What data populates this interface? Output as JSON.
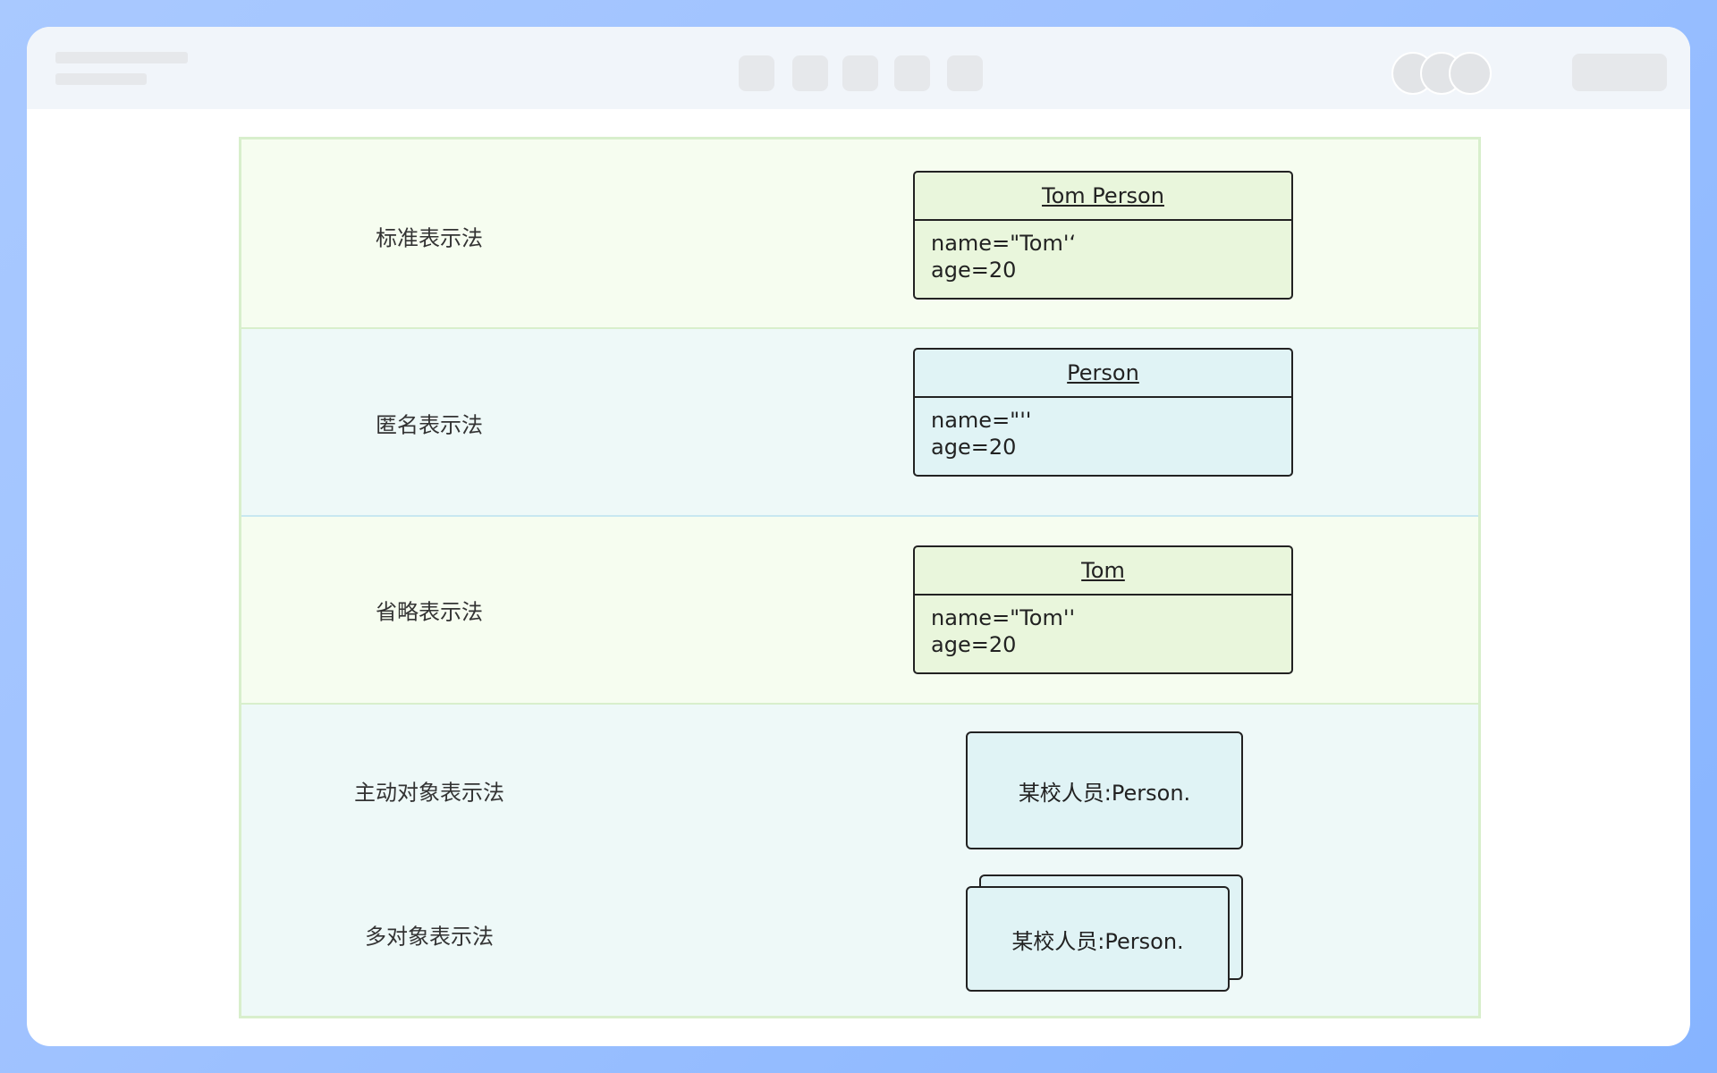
{
  "rows": [
    {
      "label": "标准表示法",
      "object": {
        "title": "Tom Person",
        "attributes": [
          "name=\"Tom'‘",
          "age=20"
        ]
      }
    },
    {
      "label": "匿名表示法",
      "object": {
        "title": "Person",
        "attributes": [
          "name=\"''",
          "age=20"
        ]
      }
    },
    {
      "label": "省略表示法",
      "object": {
        "title": "Tom",
        "attributes": [
          "name=\"Tom''",
          "age=20"
        ]
      }
    },
    {
      "label": "主动对象表示法",
      "object": {
        "title": "某校人员:Person."
      }
    },
    {
      "label": "多对象表示法",
      "object": {
        "title": "某校人员:Person."
      }
    }
  ],
  "colors": {
    "green_band": "#f6fdf0",
    "blue_band": "#eef9f8",
    "green_box": "#e9f6dc",
    "blue_box": "#e0f3f5",
    "outer_gradient": "#9fc2ff"
  }
}
